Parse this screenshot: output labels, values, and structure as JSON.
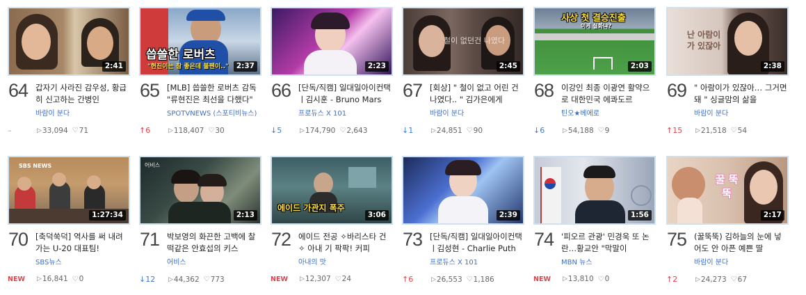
{
  "videos": [
    {
      "rank": "64",
      "duration": "2:41",
      "title": "갑자기 사라진 감우성, 황급히 신고하는 간병인",
      "channel": "바람이 분다",
      "change": "–",
      "change_type": "same",
      "views": "33,094",
      "likes": "71",
      "thumb_text": ""
    },
    {
      "rank": "65",
      "duration": "2:37",
      "title": "[MLB] 씁쓸한 로버츠 감독 \"류현진은 최선을 다했다\"",
      "channel": "SPOTVNEWS (스포티비뉴스)",
      "change": "↑6",
      "change_type": "up",
      "views": "118,407",
      "likes": "30",
      "thumb_text": "씁쓸한 로버츠",
      "thumb_sub": "\"현진이는 참 좋은데 불펜이..\""
    },
    {
      "rank": "66",
      "duration": "2:23",
      "title": "[단독/직캠] 일대일아이컨택ㅣ김시훈 - Bruno Mars",
      "channel": "프로듀스 X 101",
      "change": "↓5",
      "change_type": "down",
      "views": "174,790",
      "likes": "2,643",
      "thumb_text": ""
    },
    {
      "rank": "67",
      "duration": "2:45",
      "title": "[회상] \" 철이 없고 어린 건 나였다.. \" 김가은에게",
      "channel": "바람이 분다",
      "change": "↓1",
      "change_type": "down",
      "views": "24,851",
      "likes": "90",
      "thumb_text": "철이 없던건 나였다"
    },
    {
      "rank": "68",
      "duration": "2:03",
      "title": "이강인 최종 이광연 활약으로 대한민국 에콰도르",
      "channel": "틴오★베에로",
      "change": "↓6",
      "change_type": "down",
      "views": "54,188",
      "likes": "9",
      "thumb_text": "사상 첫 결승진출",
      "thumb_sub": "이게 실화냐?"
    },
    {
      "rank": "69",
      "duration": "2:38",
      "title": "\" 아람이가 있잖아… 그거면 돼 \" 싱글맘의 삶을",
      "channel": "바람이 분다",
      "change": "↑15",
      "change_type": "up",
      "views": "21,518",
      "likes": "54",
      "thumb_text": "난 아람이가 있잖아"
    },
    {
      "rank": "70",
      "duration": "1:27:34",
      "title": "[축덕쑥덕] 역사를 써 내려가는 U-20 대표팀!",
      "channel": "SBS뉴스",
      "change": "NEW",
      "change_type": "new",
      "views": "16,841",
      "likes": "0",
      "thumb_text": "SBS NEWS"
    },
    {
      "rank": "71",
      "duration": "2:13",
      "title": "박보영의 화끈한 고백에 찰떡같은 안효섭의 키스",
      "channel": "어비스",
      "change": "↓12",
      "change_type": "down",
      "views": "44,362",
      "likes": "773",
      "thumb_text": "어비스"
    },
    {
      "rank": "72",
      "duration": "3:06",
      "title": "에이드 전공 ✧바리스타 건✧ 아내 기 팍팍! 커피",
      "channel": "아내의 맛",
      "change": "NEW",
      "change_type": "new",
      "views": "12,307",
      "likes": "24",
      "thumb_text": "에이드 가관지 폭주"
    },
    {
      "rank": "73",
      "duration": "2:39",
      "title": "[단독/직캠] 일대일아이컨택ㅣ김성현 - Charlie Puth",
      "channel": "프로듀스 X 101",
      "change": "↑6",
      "change_type": "up",
      "views": "26,553",
      "likes": "1,186",
      "thumb_text": ""
    },
    {
      "rank": "74",
      "duration": "1:56",
      "title": "'피오르 관광' 민경욱 또 논란…황교안 \"막말이",
      "channel": "MBN 뉴스",
      "change": "NEW",
      "change_type": "new",
      "views": "13,810",
      "likes": "0",
      "thumb_text": ""
    },
    {
      "rank": "75",
      "duration": "2:17",
      "title": "(꿀뚝뚝) 김하늘의 눈에 넣어도 안 아픈 예쁜 딸",
      "channel": "바람이 분다",
      "change": "↑2",
      "change_type": "up",
      "views": "24,273",
      "likes": "67",
      "thumb_text": "꿀 뚝뚝"
    }
  ],
  "icons": {
    "play": "play-icon",
    "like": "heart-icon"
  }
}
